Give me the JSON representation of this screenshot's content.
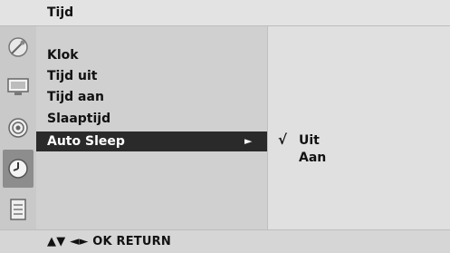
{
  "header": {
    "title": "Tijd"
  },
  "sidebar": {
    "icons": [
      "satellite-dish-icon",
      "monitor-icon",
      "speaker-icon",
      "clock-icon",
      "keypad-icon"
    ],
    "active": "clock-icon"
  },
  "menu": {
    "items": [
      {
        "label": "Klok"
      },
      {
        "label": "Tijd uit"
      },
      {
        "label": "Tijd aan"
      },
      {
        "label": "Slaaptijd"
      },
      {
        "label": "Auto Sleep",
        "selected": true,
        "arrow": "►"
      }
    ]
  },
  "submenu": {
    "check_mark": "√",
    "options": [
      {
        "label": "Uit",
        "checked": true
      },
      {
        "label": "Aan",
        "checked": false
      }
    ]
  },
  "footer": {
    "hint": "▲▼  ◄►  OK  RETURN"
  },
  "colors": {
    "selected_bg": "#2a2a2a",
    "active_icon_bg": "#8d8d8d",
    "panel_bg": "#d0d0d0"
  }
}
